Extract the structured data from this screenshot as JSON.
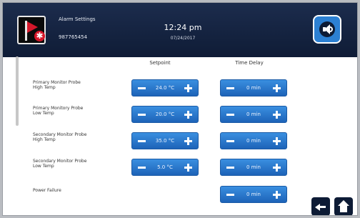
{
  "header": {
    "title": "Alarm Settings",
    "serial": "987765454",
    "time": "12:24 pm",
    "date": "07/24/2017"
  },
  "columns": {
    "setpoint": "Setpoint",
    "time_delay": "Time Delay"
  },
  "rows": [
    {
      "label_line1": "Primary Monitor Probe",
      "label_line2": "High Temp",
      "setpoint": "24.0 °C",
      "delay": "0 min"
    },
    {
      "label_line1": "Primary Monitory Probe",
      "label_line2": "Low Temp",
      "setpoint": "20.0 °C",
      "delay": "0 min"
    },
    {
      "label_line1": "Secondary Monitor Probe",
      "label_line2": "High Temp",
      "setpoint": "35.0 °C",
      "delay": "0 min"
    },
    {
      "label_line1": "Secondary Monitor Probe",
      "label_line2": "Low Temp",
      "setpoint": "5.0 °C",
      "delay": "0 min"
    },
    {
      "label_line1": "Power Failure",
      "label_line2": "",
      "setpoint": null,
      "delay": "0 min"
    }
  ],
  "icons": {
    "alarm": "alarm-flag-icon",
    "sound": "speaker-icon",
    "back": "back-arrow-icon",
    "home": "home-icon"
  },
  "colors": {
    "header": "#14223f",
    "accent": "#2c80d3",
    "alarm": "#d5172a"
  }
}
